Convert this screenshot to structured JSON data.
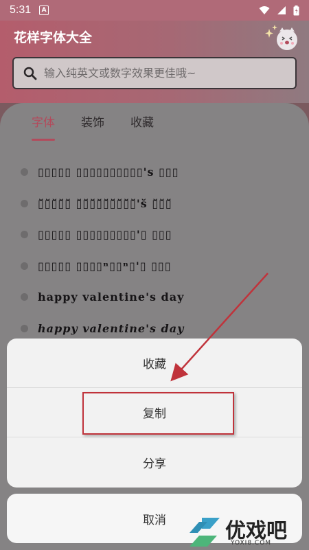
{
  "status_bar": {
    "time": "5:31",
    "notification_glyph": "A"
  },
  "header": {
    "title": "花样字体大全",
    "search_placeholder": "输入纯英文或数字效果更佳哦~"
  },
  "tabs": [
    {
      "label": "字体",
      "active": true
    },
    {
      "label": "装饰",
      "active": false
    },
    {
      "label": "收藏",
      "active": false
    }
  ],
  "font_list": [
    {
      "text": "▯▯▯▯▯ ▯▯▯▯▯▯▯▯▯▯'s ▯▯▯",
      "italic": false
    },
    {
      "text": "▯̆▯̆▯̆▯̆▯̆ ▯̆▯̆▯̆▯̆▯̆▯̆▯̆▯̆▯̆'s̆ ▯̆▯̆▯̆",
      "italic": false
    },
    {
      "text": "▯▯▯▯▯ ▯▯▯▯▯▯▯▯▯'▯ ▯▯▯",
      "italic": false
    },
    {
      "text": "▯▯▯▯▯ ▯▯▯▯ⁿ▯▯ⁿ▯'▯ ▯▯▯",
      "italic": false
    },
    {
      "text": "happy valentine's day",
      "italic": false
    },
    {
      "text": "happy valentine's day",
      "italic": true
    }
  ],
  "action_sheet": {
    "options": [
      "收藏",
      "复制",
      "分享"
    ],
    "cancel": "取消"
  },
  "watermark": {
    "brand": "优戏吧",
    "domain": "YOXI8.COM"
  },
  "colors": {
    "accent": "#b24b5c",
    "annotation": "#c0333b"
  }
}
